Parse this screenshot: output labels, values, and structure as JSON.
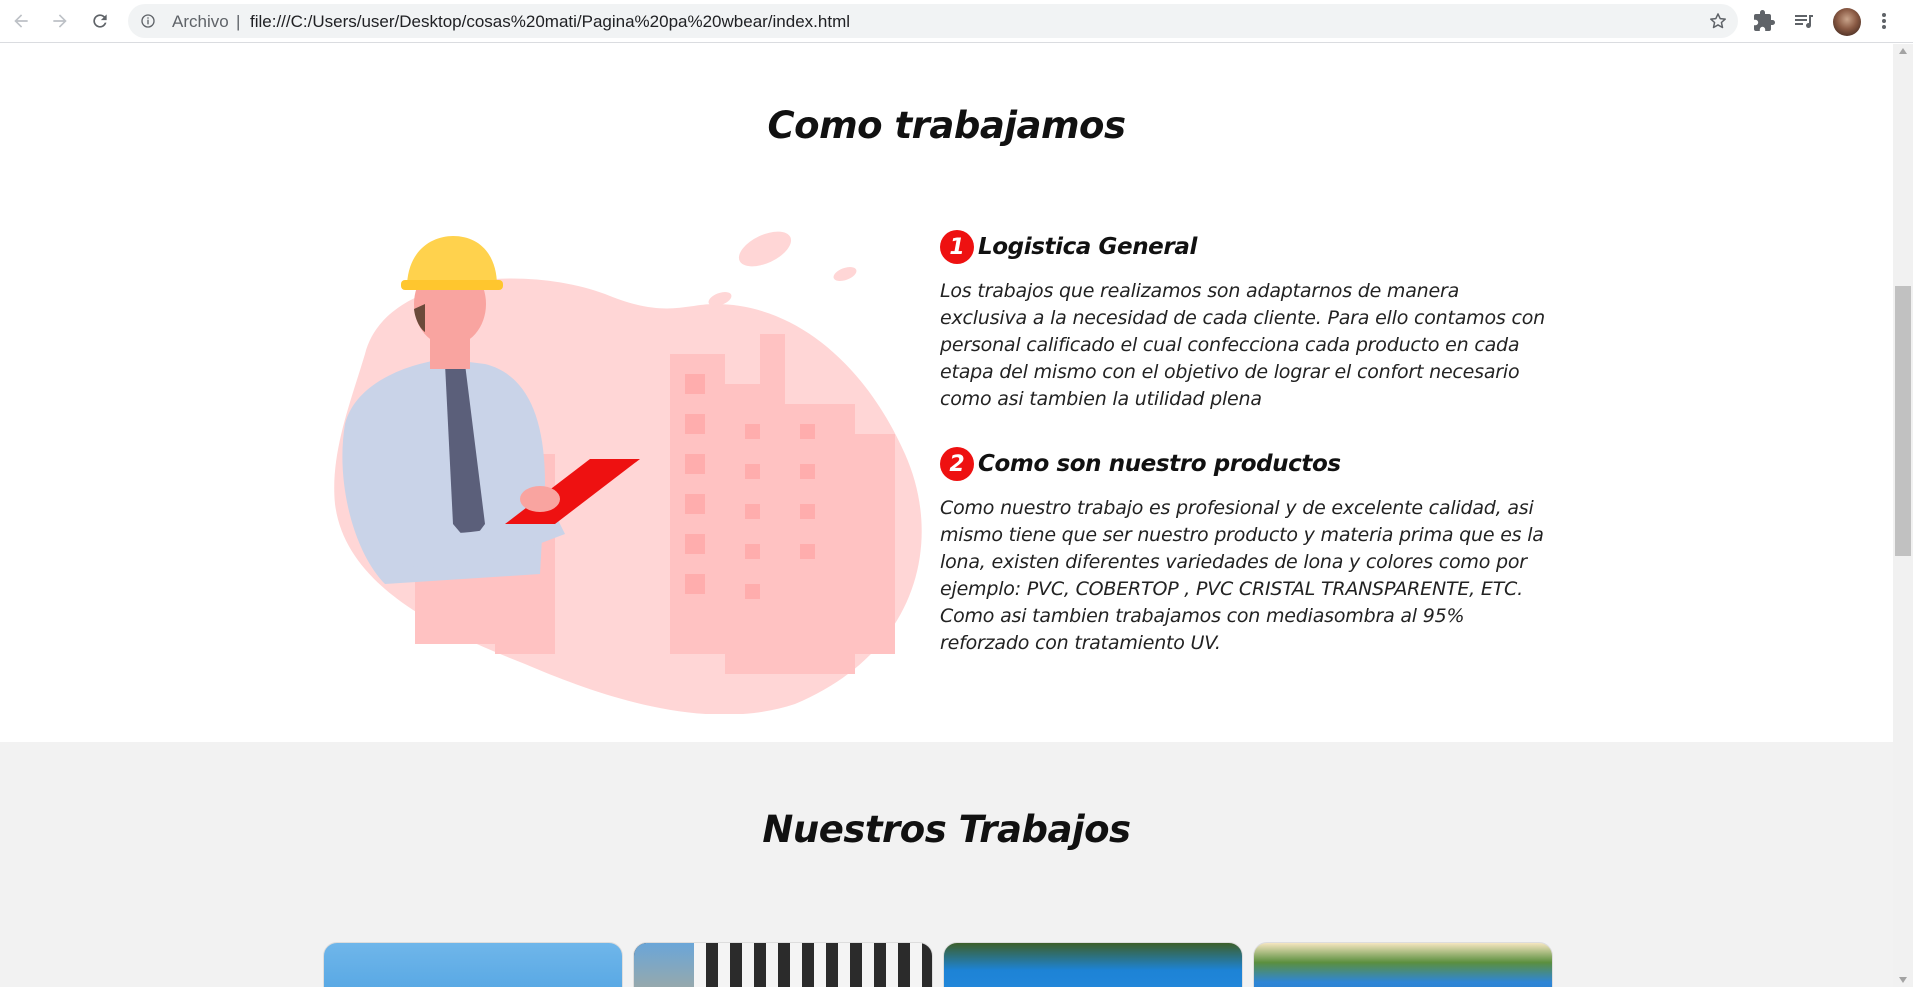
{
  "browser": {
    "scheme_label": "Archivo",
    "separator": "|",
    "url": "file:///C:/Users/user/Desktop/cosas%20mati/Pagina%20pa%20wbear/index.html",
    "icons": [
      "back-icon",
      "forward-icon",
      "reload-icon",
      "info-icon",
      "star-icon",
      "extensions-icon",
      "media-icon",
      "avatar",
      "menu-icon"
    ]
  },
  "section_how": {
    "title": "Como trabajamos",
    "features": [
      {
        "number": "1",
        "title": "Logistica General",
        "text": "Los trabajos que realizamos son adaptarnos de manera exclusiva a la necesidad de cada cliente. Para ello contamos con personal calificado el cual confecciona cada producto en cada etapa del mismo con el objetivo de lograr el confort necesario como asi tambien la utilidad plena"
      },
      {
        "number": "2",
        "title": "Como son nuestro productos",
        "text": "Como nuestro trabajo es profesional y de excelente calidad, asi mismo tiene que ser nuestro producto y materia prima que es la lona, existen diferentes variedades de lona y colores como por ejemplo: PVC, COBERTOP , PVC CRISTAL TRANSPARENTE, ETC. Como asi tambien trabajamos con mediasombra al 95% reforzado con tratamiento UV."
      }
    ]
  },
  "section_works": {
    "title": "Nuestros Trabajos"
  },
  "colors": {
    "accent": "#ee1111",
    "blob": "#ffd1d1",
    "helmet": "#ffd24d",
    "gray_section": "#f2f2f2"
  }
}
